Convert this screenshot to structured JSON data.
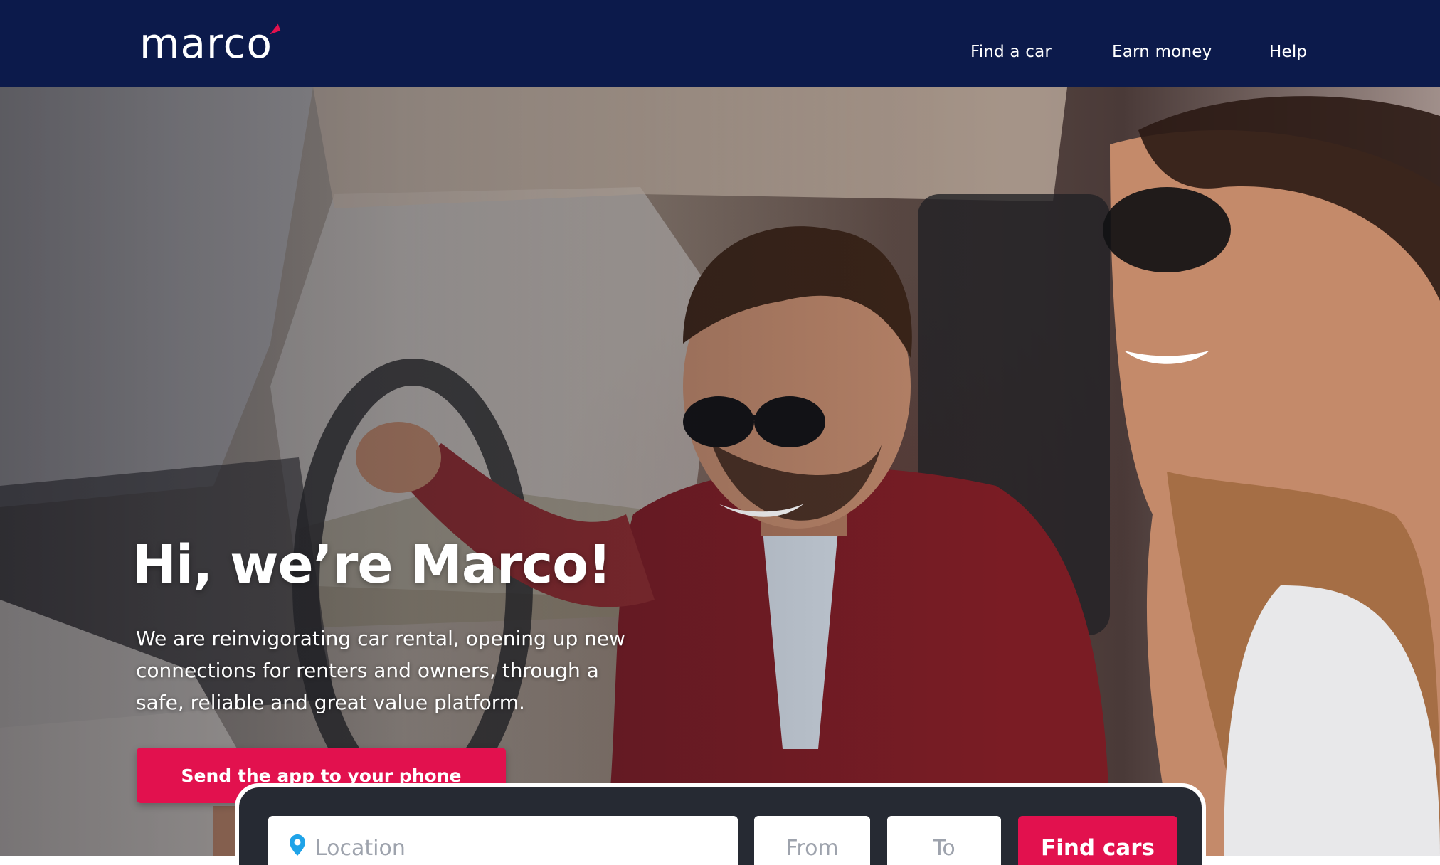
{
  "header": {
    "logo_text": "marco",
    "nav": [
      "Find a car",
      "Earn money",
      "Help"
    ]
  },
  "hero": {
    "title": "Hi, we’re Marco!",
    "description": "We are reinvigorating car rental, opening up new connections for renters and owners, through a safe, reliable and great value platform.",
    "cta_label": "Send the app to your phone",
    "image_alt": "Smiling man in sunglasses driving a car with a woman passenger"
  },
  "search": {
    "location_placeholder": "Location",
    "from_placeholder": "From",
    "to_placeholder": "To",
    "submit_label": "Find cars",
    "location_icon": "map-pin-icon"
  },
  "colors": {
    "header_bg": "#0c1a4b",
    "accent": "#e2114e",
    "search_panel_bg": "#262a33",
    "pin": "#1fa3e8"
  }
}
